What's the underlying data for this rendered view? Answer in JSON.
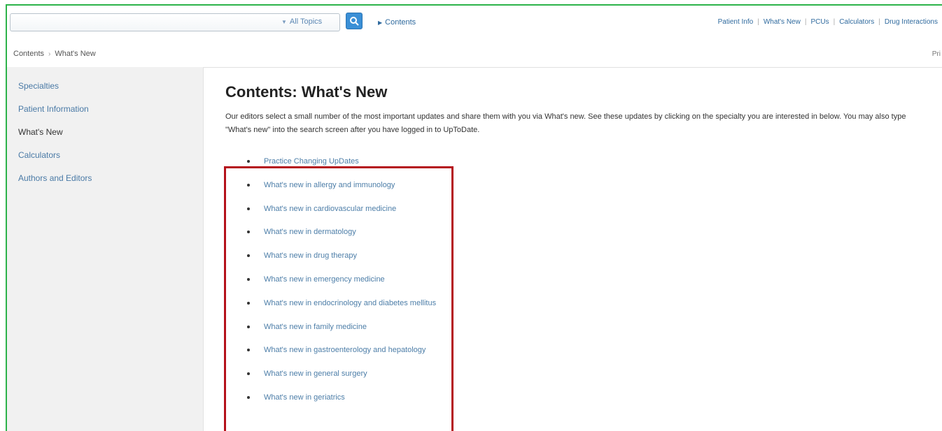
{
  "toolbar": {
    "search_placeholder": "",
    "topic_select": "All Topics",
    "contents_link": "Contents",
    "nav": [
      "Patient Info",
      "What's New",
      "PCUs",
      "Calculators",
      "Drug Interactions"
    ]
  },
  "breadcrumb": {
    "root": "Contents",
    "current": "What's New",
    "right_text": "Pri"
  },
  "sidebar": {
    "items": [
      {
        "label": "Specialties",
        "active": false
      },
      {
        "label": "Patient Information",
        "active": false
      },
      {
        "label": "What's New",
        "active": true
      },
      {
        "label": "Calculators",
        "active": false
      },
      {
        "label": "Authors and Editors",
        "active": false
      }
    ]
  },
  "main": {
    "title": "Contents: What's New",
    "intro": "Our editors select a small number of the most important updates and share them with you via What's new. See these updates by clicking on the specialty you are interested in below. You may also type \"What's new\" into the search screen after you have logged in to UpToDate.",
    "links": [
      "Practice Changing UpDates",
      "What's new in allergy and immunology",
      "What's new in cardiovascular medicine",
      "What's new in dermatology",
      "What's new in drug therapy",
      "What's new in emergency medicine",
      "What's new in endocrinology and diabetes mellitus",
      "What's new in family medicine",
      "What's new in gastroenterology and hepatology",
      "What's new in general surgery",
      "What's new in geriatrics"
    ]
  },
  "colors": {
    "frame_border": "#2db34a",
    "highlight_border": "#b5121b",
    "link": "#4d7ea8",
    "search_button": "#3a8fd6"
  }
}
